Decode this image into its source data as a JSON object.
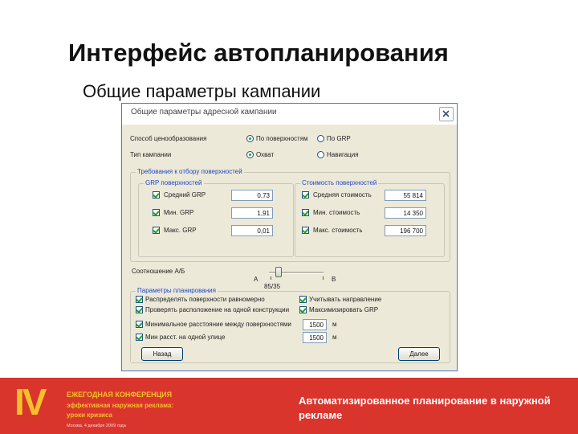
{
  "slide": {
    "title": "Интерфейс автопланирования",
    "subtitle": "Общие параметры кампании"
  },
  "window": {
    "title": "Общие параметры адресной кампании",
    "close_icon": "close-x-icon"
  },
  "pricing": {
    "label": "Способ ценообразования",
    "options": [
      "По поверхностям",
      "По GRP"
    ],
    "selected": "По поверхностям"
  },
  "campaign_type": {
    "label": "Тип кампании",
    "options": [
      "Охват",
      "Навигация"
    ],
    "selected": "Охват"
  },
  "requirements": {
    "title": "Требования к отбору поверхностей",
    "grp": {
      "title": "GRP поверхностей",
      "rows": [
        {
          "label": "Средний GRP",
          "value": "0,73",
          "checked": true
        },
        {
          "label": "Мин. GRP",
          "value": "1,91",
          "checked": true
        },
        {
          "label": "Макс. GRP",
          "value": "0,01",
          "checked": true
        }
      ]
    },
    "cost": {
      "title": "Стоимость поверхностей",
      "rows": [
        {
          "label": "Средняя стоимость",
          "value": "55 814",
          "checked": true
        },
        {
          "label": "Мин. стоимость",
          "value": "14 350",
          "checked": true
        },
        {
          "label": "Макс. стоимость",
          "value": "196 700",
          "checked": true
        }
      ]
    }
  },
  "ratio": {
    "label": "Соотношение А/Б",
    "left": "A",
    "right": "B",
    "value": "85/35",
    "position": 0.12
  },
  "placement": {
    "title": "Параметры планирования",
    "left_options": [
      {
        "label": "Распределять поверхности равномерно",
        "checked": true
      },
      {
        "label": "Проверять расположение на одной конструкции",
        "checked": true
      },
      {
        "label": "Минимальное расстояние между поверхностями",
        "checked": true
      },
      {
        "label": "Мин расст. на одной улице",
        "checked": true
      }
    ],
    "right_options": [
      {
        "label": "Учитывать направление",
        "checked": true
      },
      {
        "label": "Максимизировать GRP",
        "checked": true
      }
    ],
    "distances": [
      {
        "value": "1500",
        "unit": "м"
      },
      {
        "value": "1500",
        "unit": "м"
      }
    ]
  },
  "buttons": {
    "back": "Назад",
    "next": "Далее"
  },
  "footer": {
    "roman": "IV",
    "conf_line1": "ЕЖЕГОДНАЯ КОНФЕРЕНЦИЯ",
    "conf_line2": "эффективная наружная реклама:",
    "conf_line3": "уроки кризиса",
    "conf_date": "Москва, 4 декабря 2009 года",
    "right_text": "Автоматизированное планирование в наружной рекламе"
  },
  "colors": {
    "footer_bg": "#d9352d",
    "footer_accent": "#f5c12b",
    "group_title": "#1f46c8",
    "dialog_bg": "#ece9d8"
  }
}
